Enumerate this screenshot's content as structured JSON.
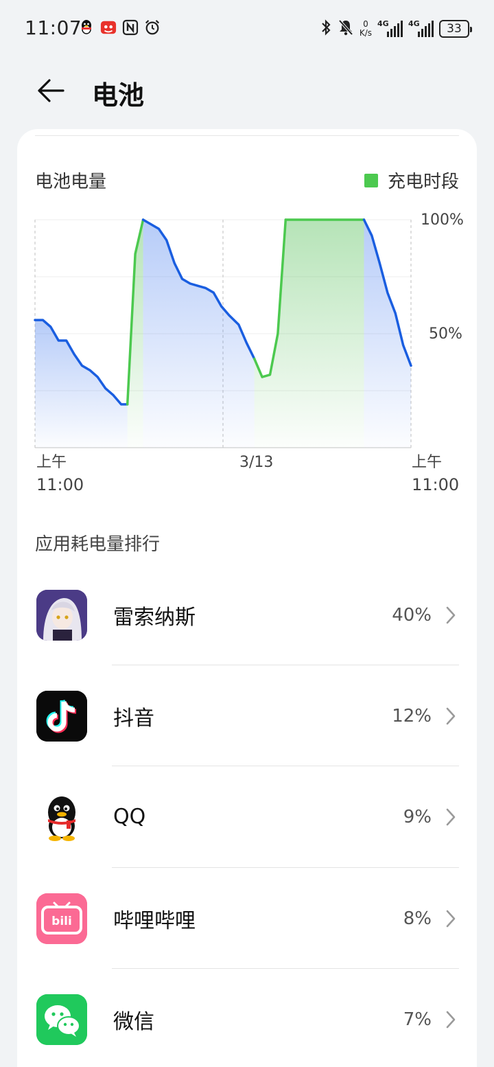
{
  "status_bar": {
    "time": "11:07",
    "left_icons": [
      "qq-icon",
      "notification-app-icon",
      "nfc-icon",
      "alarm-icon"
    ],
    "right_icons": [
      "bluetooth-icon",
      "mute-icon",
      "network-speed",
      "4g-signal-icon",
      "4g-signal-icon",
      "battery-icon"
    ],
    "net_speed_value": "0",
    "net_speed_unit": "K/s",
    "sim1_label": "4G",
    "sim2_label": "4G",
    "battery_level": "33"
  },
  "header": {
    "back_icon": "back-arrow-icon",
    "title": "电池"
  },
  "chart": {
    "title": "电池电量",
    "legend_label": "充电时段",
    "legend_color": "#4cc94f",
    "discharge_color": "#1a5ee0",
    "x_labels": [
      {
        "line1": "上午",
        "line2": "11:00"
      },
      {
        "line1": "3/13",
        "line2": ""
      },
      {
        "line1": "上午",
        "line2": "11:00"
      }
    ],
    "y_labels": [
      "100%",
      "50%"
    ]
  },
  "chart_data": {
    "type": "line",
    "title": "电池电量",
    "y_unit": "%",
    "ylim": [
      0,
      100
    ],
    "x_range_hours": [
      0,
      24
    ],
    "legend": [
      "充电时段"
    ],
    "grid": true,
    "x_ticks": [
      "上午 11:00",
      "3/13",
      "上午 11:00"
    ],
    "y_ticks": [
      "100%",
      "50%"
    ],
    "series": [
      {
        "x": [
          0,
          0.5,
          1.0,
          1.5,
          2.0,
          2.5,
          3.0,
          3.5,
          4.0,
          4.5,
          5.0,
          5.5,
          5.9
        ],
        "y": [
          56,
          56,
          53,
          47,
          47,
          41,
          36,
          34,
          31,
          26,
          23,
          19,
          19
        ],
        "kind": "discharge"
      },
      {
        "x": [
          5.9,
          6.4,
          6.9
        ],
        "y": [
          19,
          85,
          100
        ],
        "kind": "charge"
      },
      {
        "x": [
          6.9,
          7.4,
          7.9,
          8.4,
          8.9,
          9.4,
          9.9,
          10.4,
          10.9,
          11.4,
          11.9,
          12.4,
          13.0,
          13.5,
          14.0
        ],
        "y": [
          100,
          98,
          96,
          91,
          81,
          74,
          72,
          71,
          70,
          68,
          62,
          58,
          54,
          46,
          39
        ],
        "kind": "discharge"
      },
      {
        "x": [
          14.0,
          14.5,
          15.0,
          15.5,
          16.0
        ],
        "y": [
          39,
          31,
          32,
          50,
          100
        ],
        "kind": "charge"
      },
      {
        "x": [
          16.0,
          18.0,
          20.0,
          21.0
        ],
        "y": [
          100,
          100,
          100,
          100
        ],
        "kind": "charge"
      },
      {
        "x": [
          21.0,
          21.5,
          22.0,
          22.5,
          23.0,
          23.5,
          24.0
        ],
        "y": [
          100,
          93,
          81,
          68,
          59,
          45,
          36
        ],
        "kind": "discharge"
      }
    ]
  },
  "ranking": {
    "title": "应用耗电量排行",
    "apps": [
      {
        "name": "雷索纳斯",
        "percent": "40%",
        "icon": "game-character-icon"
      },
      {
        "name": "抖音",
        "percent": "12%",
        "icon": "tiktok-icon"
      },
      {
        "name": "QQ",
        "percent": "9%",
        "icon": "qq-penguin-icon"
      },
      {
        "name": "哔哩哔哩",
        "percent": "8%",
        "icon": "bilibili-icon"
      },
      {
        "name": "微信",
        "percent": "7%",
        "icon": "wechat-icon"
      }
    ]
  }
}
